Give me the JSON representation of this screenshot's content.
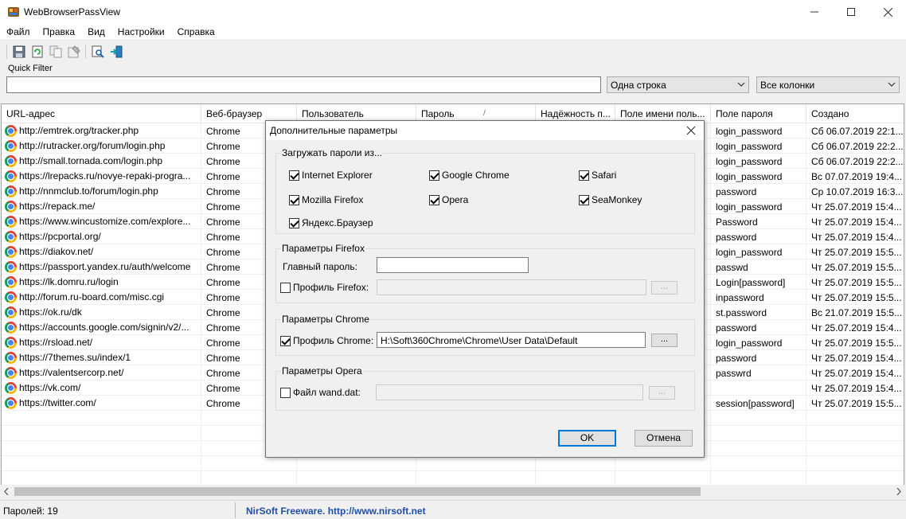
{
  "window": {
    "title": "WebBrowserPassView"
  },
  "menu": [
    "Файл",
    "Правка",
    "Вид",
    "Настройки",
    "Справка"
  ],
  "toolbar": {
    "icons": [
      "save-icon",
      "refresh-icon",
      "copy-icon",
      "properties-icon",
      "find-icon",
      "exit-icon"
    ]
  },
  "quick_filter": {
    "label": "Quick Filter",
    "value": "",
    "mode": "Одна строка",
    "columns": "Все колонки"
  },
  "table": {
    "columns": [
      "URL-адрес",
      "Веб-браузер",
      "Пользователь",
      "Пароль",
      "Надёжность п...",
      "Поле имени поль...",
      "Поле пароля",
      "Создано"
    ],
    "sort_indicator": "/",
    "rows": [
      {
        "url": "http://emtrek.org/tracker.php",
        "browser": "Chrome",
        "field": "login_password",
        "created": "Сб 06.07.2019 22:1..."
      },
      {
        "url": "http://rutracker.org/forum/login.php",
        "browser": "Chrome",
        "field": "login_password",
        "created": "Сб 06.07.2019 22:2..."
      },
      {
        "url": "http://small.tornada.com/login.php",
        "browser": "Chrome",
        "field": "login_password",
        "created": "Сб 06.07.2019 22:2..."
      },
      {
        "url": "https://lrepacks.ru/novye-repaki-progra...",
        "browser": "Chrome",
        "field": "login_password",
        "created": "Вс 07.07.2019 19:4..."
      },
      {
        "url": "http://nnmclub.to/forum/login.php",
        "browser": "Chrome",
        "field": "password",
        "created": "Ср 10.07.2019 16:3..."
      },
      {
        "url": "https://repack.me/",
        "browser": "Chrome",
        "field": "login_password",
        "created": "Чт 25.07.2019 15:4..."
      },
      {
        "url": "https://www.wincustomize.com/explore...",
        "browser": "Chrome",
        "field": "Password",
        "created": "Чт 25.07.2019 15:4..."
      },
      {
        "url": "https://pcportal.org/",
        "browser": "Chrome",
        "field": "password",
        "created": "Чт 25.07.2019 15:4..."
      },
      {
        "url": "https://diakov.net/",
        "browser": "Chrome",
        "field": "login_password",
        "created": "Чт 25.07.2019 15:5..."
      },
      {
        "url": "https://passport.yandex.ru/auth/welcome",
        "browser": "Chrome",
        "field": "passwd",
        "created": "Чт 25.07.2019 15:5..."
      },
      {
        "url": "https://lk.domru.ru/login",
        "browser": "Chrome",
        "field": "Login[password]",
        "created": "Чт 25.07.2019 15:5..."
      },
      {
        "url": "http://forum.ru-board.com/misc.cgi",
        "browser": "Chrome",
        "field": "inpassword",
        "created": "Чт 25.07.2019 15:5..."
      },
      {
        "url": "https://ok.ru/dk",
        "browser": "Chrome",
        "field": "st.password",
        "created": "Вс 21.07.2019 15:5..."
      },
      {
        "url": "https://accounts.google.com/signin/v2/...",
        "browser": "Chrome",
        "field": "password",
        "created": "Чт 25.07.2019 15:4..."
      },
      {
        "url": "https://rsload.net/",
        "browser": "Chrome",
        "field": "login_password",
        "created": "Чт 25.07.2019 15:5..."
      },
      {
        "url": "https://7themes.su/index/1",
        "browser": "Chrome",
        "field": "password",
        "created": "Чт 25.07.2019 15:4..."
      },
      {
        "url": "https://valentsercorp.net/",
        "browser": "Chrome",
        "field": "passwrd",
        "created": "Чт 25.07.2019 15:4..."
      },
      {
        "url": "https://vk.com/",
        "browser": "Chrome",
        "field": "",
        "created": "Чт 25.07.2019 15:4..."
      },
      {
        "url": "https://twitter.com/",
        "browser": "Chrome",
        "field": "session[password]",
        "created": "Чт 25.07.2019 15:5..."
      }
    ]
  },
  "status": {
    "count": "Паролей: 19",
    "credit": "NirSoft Freeware.  http://www.nirsoft.net"
  },
  "dialog": {
    "title": "Дополнительные параметры",
    "load_group": {
      "label": "Загружать пароли из...",
      "items": [
        {
          "label": "Internet Explorer",
          "checked": true
        },
        {
          "label": "Google Chrome",
          "checked": true
        },
        {
          "label": "Safari",
          "checked": true
        },
        {
          "label": "Mozilla Firefox",
          "checked": true
        },
        {
          "label": "Opera",
          "checked": true
        },
        {
          "label": "SeaMonkey",
          "checked": true
        },
        {
          "label": "Яндекс.Браузер",
          "checked": true
        }
      ]
    },
    "firefox_group": {
      "label": "Параметры Firefox",
      "master_password_label": "Главный пароль:",
      "master_password_value": "",
      "profile_label": "Профиль Firefox:",
      "profile_checked": false,
      "profile_value": "",
      "browse": "..."
    },
    "chrome_group": {
      "label": "Параметры Chrome",
      "profile_label": "Профиль Chrome:",
      "profile_checked": true,
      "profile_value": "H:\\Soft\\360Chrome\\Chrome\\User Data\\Default",
      "browse": "..."
    },
    "opera_group": {
      "label": "Параметры Opera",
      "wand_label": "Файл wand.dat:",
      "wand_checked": false,
      "wand_value": "",
      "browse": "..."
    },
    "ok": "OK",
    "cancel": "Отмена"
  }
}
